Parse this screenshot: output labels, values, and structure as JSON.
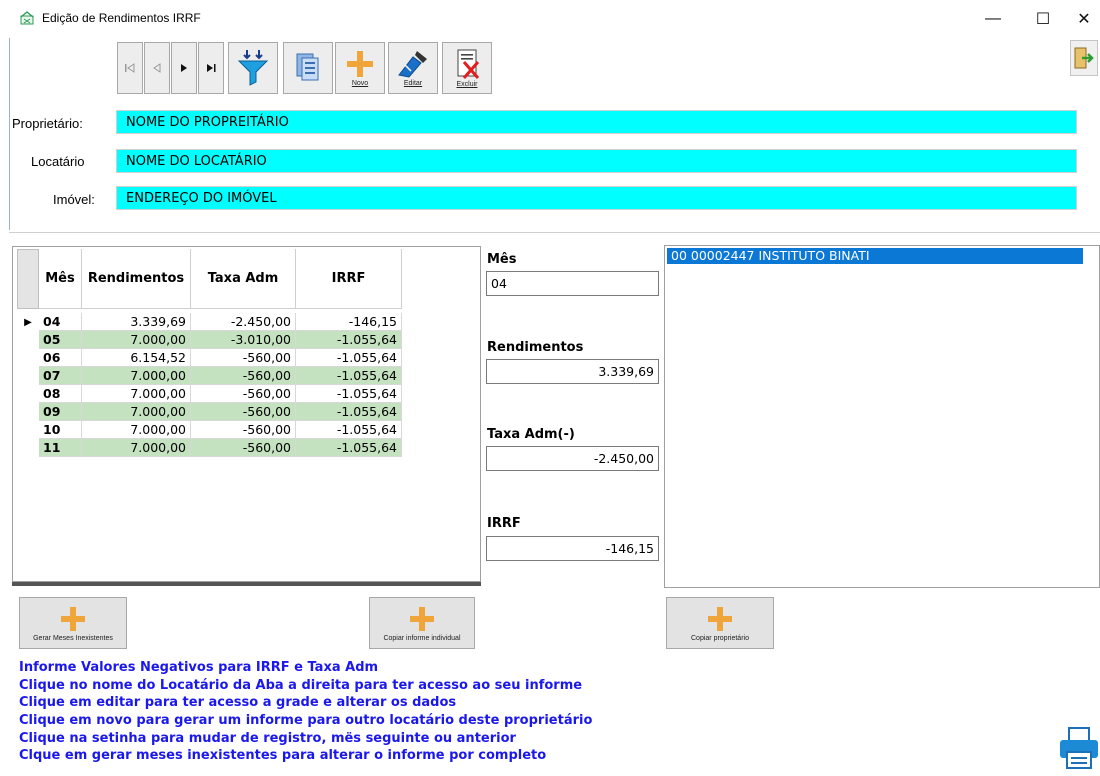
{
  "window": {
    "title": "Edição de Rendimentos IRRF",
    "minimize": "—",
    "maximize": "☐",
    "close": "✕"
  },
  "toolbar": {
    "novo_label": "Novo",
    "editar_label": "Editar",
    "excluir_label": "Excluir",
    "icons": [
      "first-record-icon",
      "prev-record-icon",
      "next-record-icon",
      "last-record-icon",
      "filter-icon",
      "copy-icon",
      "plus-icon",
      "edit-icon",
      "delete-icon",
      "exit-icon"
    ]
  },
  "fields": {
    "proprietario_label": "Proprietário:",
    "proprietario_value": "NOME DO PROPREITÁRIO",
    "locatario_label": "Locatário",
    "locatario_value": "NOME DO LOCATÁRIO",
    "imovel_label": "Imóvel:",
    "imovel_value": "ENDEREÇO DO IMÓVEL"
  },
  "grid": {
    "headers": [
      "Mês",
      "Rendimentos",
      "Taxa Adm",
      "IRRF"
    ],
    "rows": [
      [
        "04",
        "3.339,69",
        "-2.450,00",
        "-146,15"
      ],
      [
        "05",
        "7.000,00",
        "-3.010,00",
        "-1.055,64"
      ],
      [
        "06",
        "6.154,52",
        "-560,00",
        "-1.055,64"
      ],
      [
        "07",
        "7.000,00",
        "-560,00",
        "-1.055,64"
      ],
      [
        "08",
        "7.000,00",
        "-560,00",
        "-1.055,64"
      ],
      [
        "09",
        "7.000,00",
        "-560,00",
        "-1.055,64"
      ],
      [
        "10",
        "7.000,00",
        "-560,00",
        "-1.055,64"
      ],
      [
        "11",
        "7.000,00",
        "-560,00",
        "-1.055,64"
      ]
    ],
    "current_row_marker": "▶",
    "alt_row_color": "#c4e2c0"
  },
  "detail": {
    "mes_label": "Mês",
    "mes_value": "04",
    "rendimentos_label": "Rendimentos",
    "rendimentos_value": "3.339,69",
    "taxa_label": "Taxa Adm(-)",
    "taxa_value": "-2.450,00",
    "irrf_label": "IRRF",
    "irrf_value": "-146,15"
  },
  "list": {
    "items": [
      "00 00002447 INSTITUTO BINATI"
    ],
    "selected_color": "#0c78d6"
  },
  "actions": {
    "gerar_label": "Gerar Meses Inexistentes",
    "copiar_individual_label": "Copiar informe individual",
    "copiar_proprietario_label": "Copiar proprietário"
  },
  "instructions": [
    "Informe Valores Negativos para IRRF e Taxa Adm",
    "Clique no nome do Locatário da Aba a direita para ter acesso ao seu informe",
    "Clique em editar para ter acesso a grade e alterar os dados",
    "Clique em novo para gerar um informe para outro locatário deste proprietário",
    "Clique na setinha para mudar de registro, mës seguinte ou anterior",
    "Clque em gerar meses inexistentes para alterar o informe por completo"
  ],
  "colors": {
    "field_cyan": "#00ffff",
    "instruction_blue": "#1b18ee",
    "plus_orange": "#f0a53a"
  }
}
